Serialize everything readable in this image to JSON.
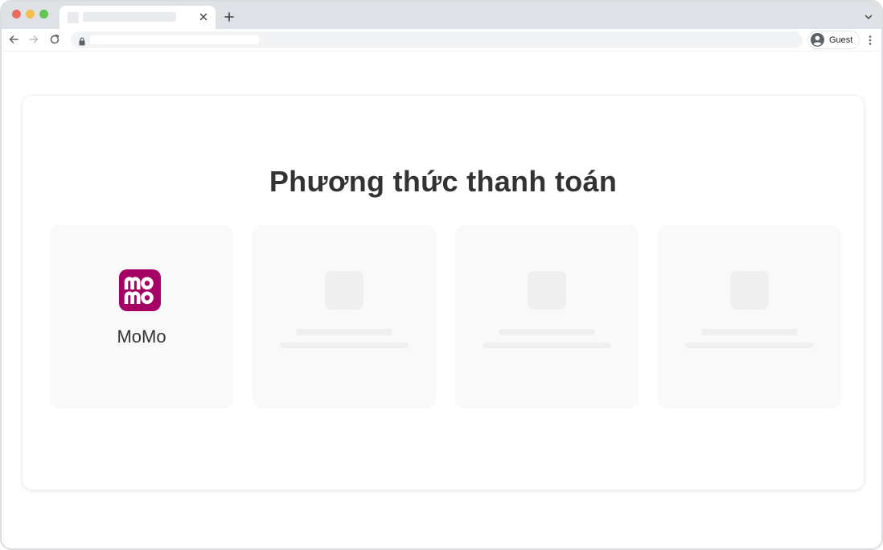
{
  "browser": {
    "profile_label": "Guest",
    "icons": {
      "close": "close-icon",
      "new_tab": "plus-icon",
      "tab_menu": "chevron-down-icon",
      "back": "arrow-left-icon",
      "forward": "arrow-right-icon",
      "reload": "reload-icon",
      "lock": "lock-icon",
      "avatar": "person-icon",
      "menu": "kebab-icon"
    }
  },
  "page": {
    "title": "Phương thức thanh toán",
    "methods": [
      {
        "name": "MoMo",
        "logo_text": "momo",
        "logo_color": "#a50064",
        "loaded": true
      },
      {
        "loaded": false
      },
      {
        "loaded": false
      },
      {
        "loaded": false
      }
    ]
  }
}
